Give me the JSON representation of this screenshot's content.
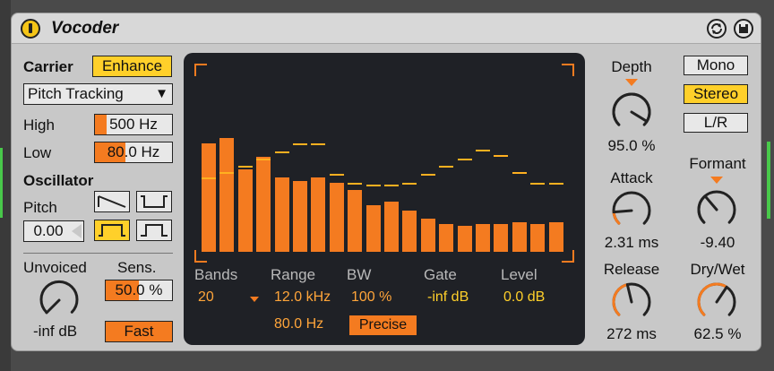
{
  "device": {
    "title": "Vocoder"
  },
  "carrier": {
    "label": "Carrier",
    "enhance_label": "Enhance",
    "mode_value": "Pitch Tracking",
    "high_label": "High",
    "high_value": "500 Hz",
    "high_fill": 0.15,
    "low_label": "Low",
    "low_value": "80.0 Hz",
    "low_fill": 0.4
  },
  "oscillator": {
    "label": "Oscillator",
    "pitch_label": "Pitch",
    "pitch_value": "0.00",
    "selected_waveform": "pulse-wave-icon"
  },
  "unvoiced": {
    "label": "Unvoiced",
    "value": "-inf dB",
    "sens_label": "Sens.",
    "sens_value": "50.0 %",
    "sens_fill": 0.5,
    "fast_label": "Fast"
  },
  "display": {
    "headers": {
      "bands": "Bands",
      "range": "Range",
      "bw": "BW",
      "gate": "Gate",
      "level": "Level"
    },
    "bands_value": "20",
    "range_high": "12.0 kHz",
    "range_low": "80.0 Hz",
    "bw_value": "100 %",
    "precise_label": "Precise",
    "gate_value": "-inf dB",
    "level_value": "0.0 dB",
    "band_levels": [
      0.58,
      0.61,
      0.44,
      0.51,
      0.4,
      0.38,
      0.4,
      0.37,
      0.33,
      0.25,
      0.27,
      0.22,
      0.18,
      0.15,
      0.14,
      0.15,
      0.15,
      0.16,
      0.15,
      0.16
    ],
    "pitch_marks": [
      0.4,
      0.43,
      0.46,
      0.5,
      0.54,
      0.58,
      0.58,
      0.42,
      0.37,
      0.36,
      0.36,
      0.37,
      0.42,
      0.46,
      0.5,
      0.55,
      0.52,
      0.43,
      0.37,
      0.37
    ],
    "colors": {
      "bars": "#f47b20",
      "marks": "#ffb020",
      "accent": "#ffd02a"
    }
  },
  "knobs": {
    "depth": {
      "label": "Depth",
      "value": "95.0 %",
      "fraction": 0.95
    },
    "attack": {
      "label": "Attack",
      "value": "2.31 ms",
      "fraction": 0.15
    },
    "release": {
      "label": "Release",
      "value": "272 ms",
      "fraction": 0.45
    },
    "formant": {
      "label": "Formant",
      "value": "-9.40",
      "fraction": 0.35
    },
    "drywet": {
      "label": "Dry/Wet",
      "value": "62.5 %",
      "fraction": 0.625
    }
  },
  "output_mode": {
    "mono_label": "Mono",
    "stereo_label": "Stereo",
    "lr_label": "L/R",
    "selected": "Stereo"
  }
}
